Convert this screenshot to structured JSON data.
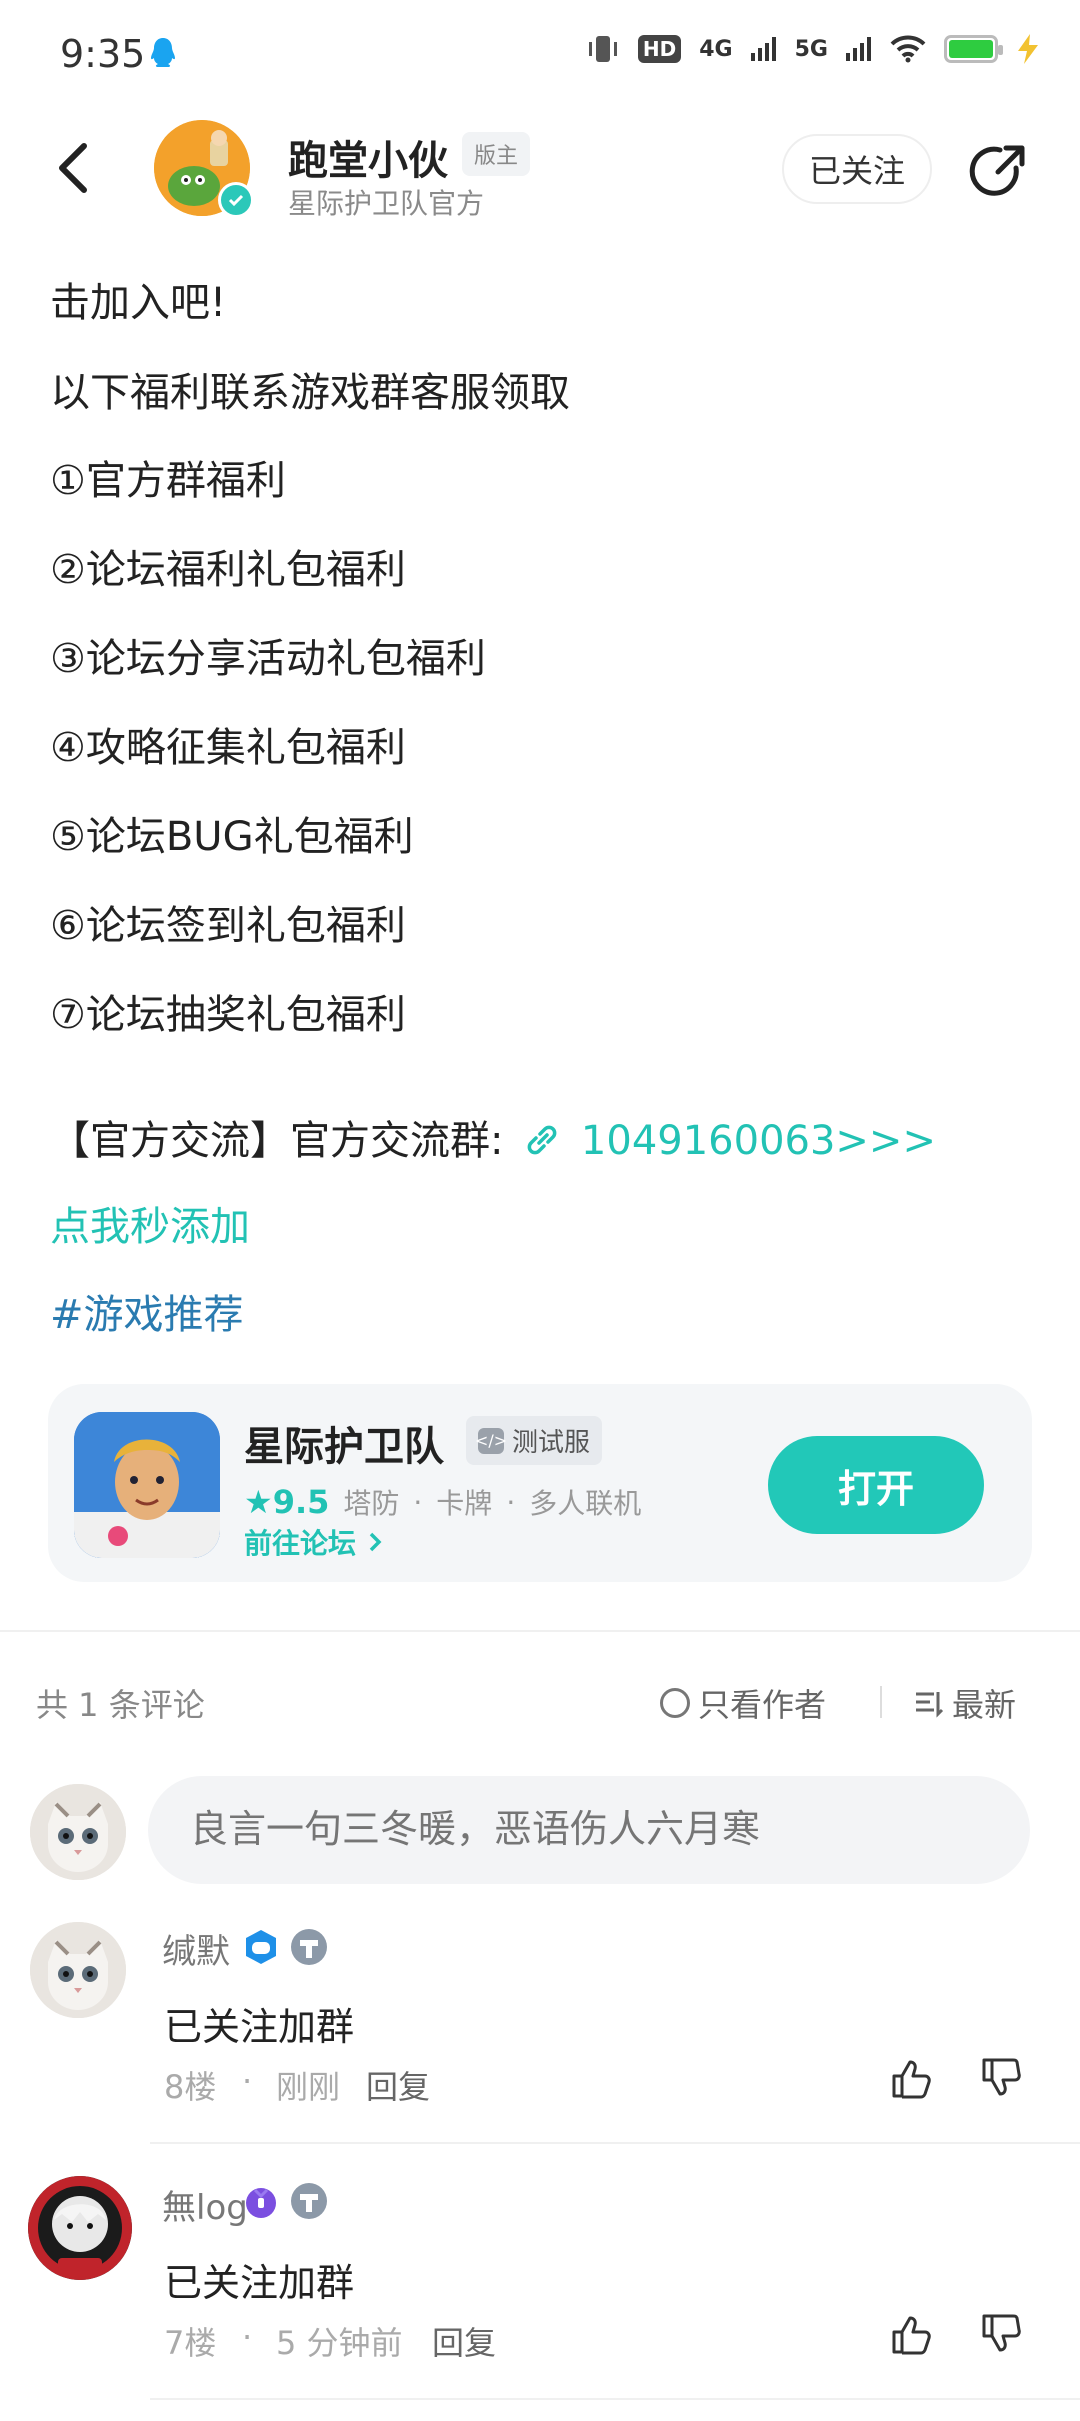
{
  "status_bar": {
    "time": "9:35",
    "network": "4G",
    "network2": "5G",
    "hd": "HD"
  },
  "header": {
    "author_name": "跑堂小伙",
    "badge": "版主",
    "subtitle": "星际护卫队官方",
    "follow_label": "已关注"
  },
  "article": {
    "lines": [
      "击加入吧!",
      "以下福利联系游戏群客服领取",
      "①官方群福利",
      "②论坛福利礼包福利",
      "③论坛分享活动礼包福利",
      "④攻略征集礼包福利",
      "⑤论坛BUG礼包福利",
      "⑥论坛签到礼包福利",
      "⑦论坛抽奖礼包福利"
    ],
    "group_prefix": "【官方交流】官方交流群:",
    "group_link": "1049160063>>>",
    "add_link": "点我秒添加",
    "hashtag": "#游戏推荐"
  },
  "game_card": {
    "name": "星际护卫队",
    "test_badge": "测试服",
    "score": "9.5",
    "tags": [
      "塔防",
      "卡牌",
      "多人联机"
    ],
    "forum_link": "前往论坛",
    "open_label": "打开"
  },
  "comments_header": {
    "count_text": "共 1 条评论",
    "only_author": "只看作者",
    "sort": "最新"
  },
  "comment_input": {
    "placeholder": "良言一句三冬暖，恶语伤人六月寒"
  },
  "comments": [
    {
      "user": "缄默",
      "text": "已关注加群",
      "floor": "8楼",
      "time": "刚刚",
      "reply": "回复"
    },
    {
      "user": "無log",
      "text": "已关注加群",
      "floor": "7楼",
      "time": "5 分钟前",
      "reply": "回复"
    }
  ],
  "colors": {
    "accent": "#22c2b4",
    "hashtag": "#2a7bb0"
  }
}
